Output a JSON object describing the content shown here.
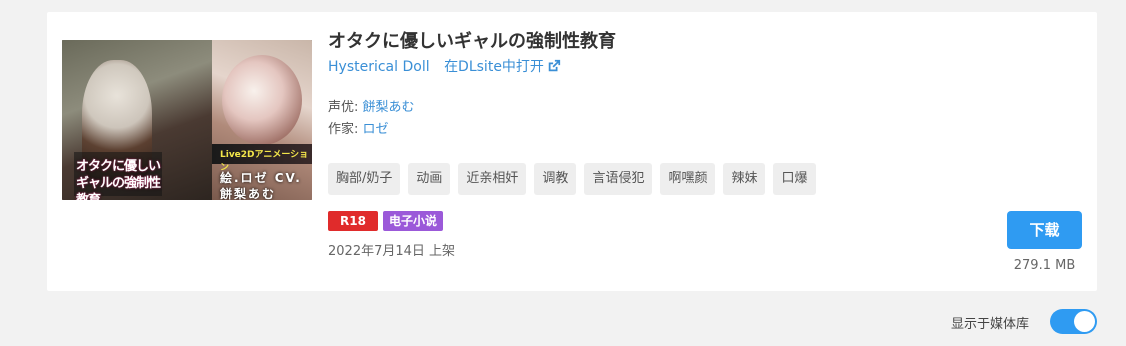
{
  "work": {
    "title": "オタクに優しいギャルの強制性教育",
    "maker": "Hysterical Doll",
    "open_link": "在DLsite中打开",
    "cv_label": "声优: ",
    "cv_value": "餅梨あむ",
    "author_label": "作家: ",
    "author_value": "ロゼ",
    "tags": [
      "胸部/奶子",
      "动画",
      "近亲相奸",
      "调教",
      "言语侵犯",
      "啊嘿颜",
      "辣妹",
      "口爆"
    ],
    "badges": {
      "rating": "R18",
      "type": "电子小说"
    },
    "date": "2022年7月14日 上架",
    "cover": {
      "title_text": "オタクに優しいギャルの強制性教育",
      "credit_text": "絵.ロゼ CV.餅梨あむ",
      "band_text": "Live2Dアニメーション"
    }
  },
  "download": {
    "label": "下载",
    "size": "279.1 MB"
  },
  "library": {
    "label": "显示于媒体库",
    "enabled": true
  },
  "colors": {
    "accent": "#2f9bf2",
    "r18": "#e02b2b",
    "novel": "#9b59d9",
    "link": "#3a8fd6"
  }
}
